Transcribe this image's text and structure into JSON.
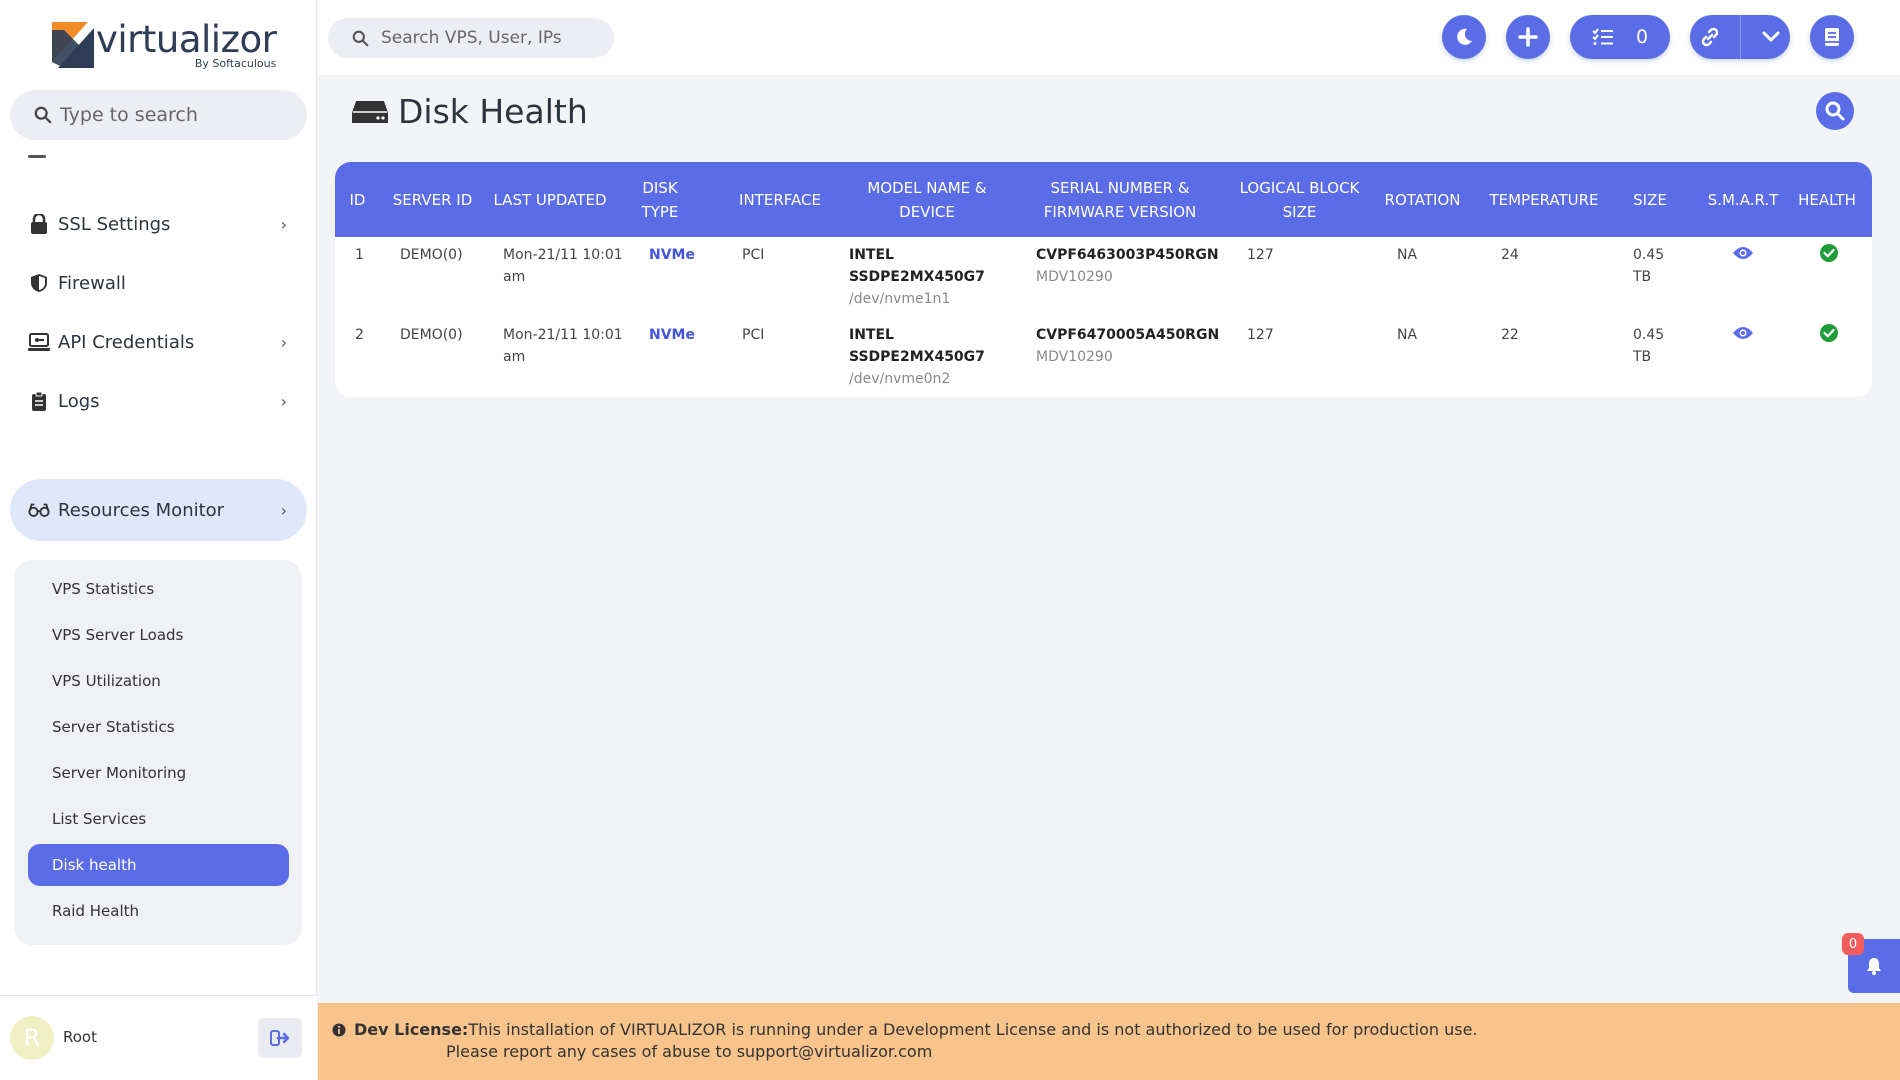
{
  "brand": {
    "name": "virtualizor",
    "by": "By Softaculous"
  },
  "sidebar": {
    "search_placeholder": "Type to search",
    "items": [
      {
        "label": "SSL Settings",
        "icon": "lock-icon"
      },
      {
        "label": "Firewall",
        "icon": "shield-icon"
      },
      {
        "label": "API Credentials",
        "icon": "monitor-icon"
      },
      {
        "label": "Logs",
        "icon": "clipboard-icon"
      },
      {
        "label": "Resources Monitor",
        "icon": "glasses-icon"
      }
    ],
    "submenu": [
      {
        "label": "VPS Statistics"
      },
      {
        "label": "VPS Server Loads"
      },
      {
        "label": "VPS Utilization"
      },
      {
        "label": "Server Statistics"
      },
      {
        "label": "Server Monitoring"
      },
      {
        "label": "List Services"
      },
      {
        "label": "Disk health"
      },
      {
        "label": "Raid Health"
      }
    ],
    "user": {
      "initial": "R",
      "name": "Root"
    }
  },
  "topbar": {
    "search_placeholder": "Search VPS, User, IPs",
    "task_count": "0"
  },
  "page": {
    "title": "Disk Health"
  },
  "table": {
    "headers": {
      "id": "ID",
      "server_id": "SERVER ID",
      "last_updated": "LAST UPDATED",
      "disk_type": "DISK TYPE",
      "interface": "INTERFACE",
      "model": "MODEL NAME & DEVICE",
      "serial": "SERIAL NUMBER & FIRMWARE VERSION",
      "block": "LOGICAL BLOCK SIZE",
      "rotation": "ROTATION",
      "temperature": "TEMPERATURE",
      "size": "SIZE",
      "smart": "S.M.A.R.T",
      "health": "HEALTH"
    },
    "rows": [
      {
        "id": "1",
        "server_id": "DEMO(0)",
        "last_updated": "Mon-21/11 10:01 am",
        "disk_type": "NVMe",
        "interface": "PCI",
        "model": "INTEL SSDPE2MX450G7",
        "device": "/dev/nvme1n1",
        "serial": "CVPF6463003P450RGN",
        "firmware": "MDV10290",
        "block": "127",
        "rotation": "NA",
        "temperature": "24",
        "size": "0.45 TB"
      },
      {
        "id": "2",
        "server_id": "DEMO(0)",
        "last_updated": "Mon-21/11 10:01 am",
        "disk_type": "NVMe",
        "interface": "PCI",
        "model": "INTEL SSDPE2MX450G7",
        "device": "/dev/nvme0n2",
        "serial": "CVPF6470005A450RGN",
        "firmware": "MDV10290",
        "block": "127",
        "rotation": "NA",
        "temperature": "22",
        "size": "0.45 TB"
      }
    ]
  },
  "notifications": {
    "count": "0"
  },
  "license": {
    "label": "Dev License:",
    "message": "This installation of VIRTUALIZOR is running under a Development License and is not authorized to be used for production use.",
    "message2": "Please report any cases of abuse to support@virtualizor.com"
  },
  "colors": {
    "accent": "#5a6de6",
    "license_bg": "#f8c48c",
    "health_ok": "#1f9d3a"
  }
}
